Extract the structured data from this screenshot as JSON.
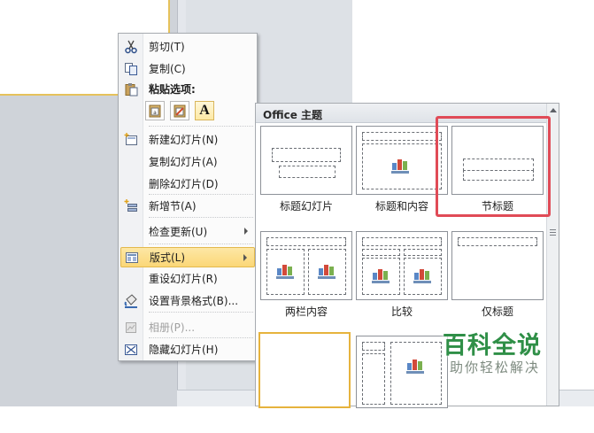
{
  "context_menu": {
    "items": [
      {
        "label": "剪切(T)",
        "icon": "scissors-icon"
      },
      {
        "label": "复制(C)",
        "icon": "copy-icon"
      },
      {
        "label": "粘贴选项:",
        "icon": "clipboard-icon"
      },
      {
        "label": "新建幻灯片(N)",
        "icon": "new-slide-icon"
      },
      {
        "label": "复制幻灯片(A)",
        "icon": ""
      },
      {
        "label": "删除幻灯片(D)",
        "icon": ""
      },
      {
        "label": "新增节(A)",
        "icon": "new-section-icon"
      },
      {
        "label": "检查更新(U)",
        "icon": ""
      },
      {
        "label": "版式(L)",
        "icon": "layout-icon"
      },
      {
        "label": "重设幻灯片(R)",
        "icon": ""
      },
      {
        "label": "设置背景格式(B)...",
        "icon": "format-background-icon"
      },
      {
        "label": "相册(P)...",
        "icon": "photo-album-icon"
      },
      {
        "label": "隐藏幻灯片(H)",
        "icon": "hide-slide-icon"
      }
    ],
    "paste_options": {
      "text_only_letter": "A"
    }
  },
  "gallery": {
    "title": "Office 主题",
    "layouts": [
      {
        "caption": "标题幻灯片"
      },
      {
        "caption": "标题和内容"
      },
      {
        "caption": "节标题"
      },
      {
        "caption": "两栏内容"
      },
      {
        "caption": "比较"
      },
      {
        "caption": "仅标题"
      }
    ]
  },
  "watermark": {
    "main": "百科全说",
    "sub": "助你轻松解决"
  },
  "colors": {
    "highlight": "#fbd777",
    "annotation_box": "#e04b57",
    "watermark_green": "#2f8f47"
  }
}
